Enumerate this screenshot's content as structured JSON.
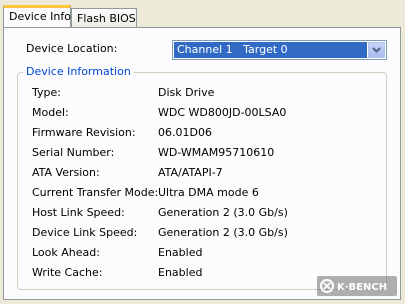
{
  "tabs": [
    {
      "label": "Device Info",
      "active": true
    },
    {
      "label": "Flash BIOS",
      "active": false
    }
  ],
  "device_location": {
    "label": "Device Location:",
    "selected": "Channel 1   Target 0"
  },
  "device_information": {
    "title": "Device Information",
    "rows": [
      {
        "label": "Type:",
        "value": "Disk Drive"
      },
      {
        "label": "Model:",
        "value": "WDC WD800JD-00LSA0"
      },
      {
        "label": "Firmware Revision:",
        "value": "06.01D06"
      },
      {
        "label": "Serial Number:",
        "value": "WD-WMAM95710610"
      },
      {
        "label": "ATA Version:",
        "value": "ATA/ATAPI-7"
      },
      {
        "label": "Current Transfer Mode:",
        "value": "Ultra DMA mode 6"
      },
      {
        "label": "Host Link Speed:",
        "value": "Generation 2 (3.0 Gb/s)"
      },
      {
        "label": "Device Link Speed:",
        "value": "Generation 2 (3.0 Gb/s)"
      },
      {
        "label": "Look Ahead:",
        "value": "Enabled"
      },
      {
        "label": "Write Cache:",
        "value": "Enabled"
      }
    ]
  },
  "watermark": {
    "text": "K·BENCH",
    "icon": "kbench-logo-icon"
  },
  "colors": {
    "window_bg": "#ece9d8",
    "panel_bg": "#fcfcfe",
    "selection": "#316ac5",
    "group_title": "#0046d5",
    "active_tab_accent": "#ffc83c"
  }
}
